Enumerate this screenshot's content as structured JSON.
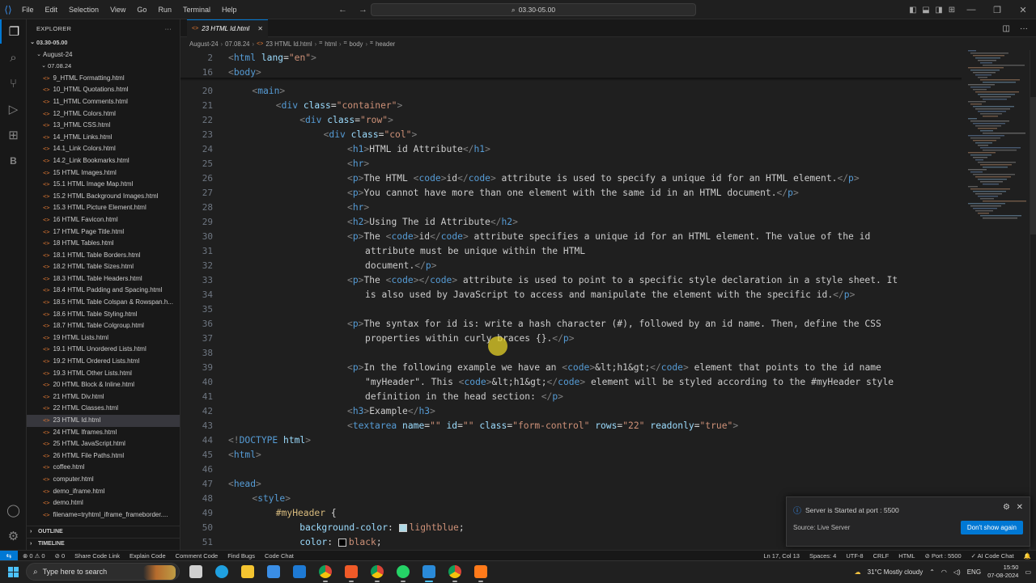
{
  "titlebar": {
    "menu": [
      "File",
      "Edit",
      "Selection",
      "View",
      "Go",
      "Run",
      "Terminal",
      "Help"
    ],
    "search": "03.30-05.00"
  },
  "sidebar": {
    "title": "EXPLORER",
    "root": "03.30-05.00",
    "folder": "August-24",
    "subfolder": "07.08.24",
    "files": [
      "9_HTML Formatting.html",
      "10_HTML Quotations.html",
      "11_HTML Comments.html",
      "12_HTML Colors.html",
      "13_HTML CSS.html",
      "14_HTML Links.html",
      "14.1_Link Colors.html",
      "14.2_Link Bookmarks.html",
      "15 HTML Images.html",
      "15.1 HTML Image Map.html",
      "15.2 HTML Background Images.html",
      "15.3 HTML Picture Element.html",
      "16 HTML Favicon.html",
      "17 HTML Page Title.html",
      "18 HTML Tables.html",
      "18.1 HTML Table Borders.html",
      "18.2 HTML Table Sizes.html",
      "18.3 HTML Table Headers.html",
      "18.4 HTML Padding and Spacing.html",
      "18.5 HTML Table Colspan & Rowspan.h...",
      "18.6 HTML Table Styling.html",
      "18.7 HTML Table Colgroup.html",
      "19 HTML Lists.html",
      "19.1 HTML Unordered Lists.html",
      "19.2 HTML Ordered Lists.html",
      "19.3 HTML Other Lists.html",
      "20 HTML Block & Inline.html",
      "21 HTML Div.html",
      "22 HTML Classes.html",
      "23 HTML Id.html",
      "24 HTML Iframes.html",
      "25 HTML JavaScript.html",
      "26 HTML File Paths.html",
      "coffee.html",
      "computer.html",
      "demo_iframe.html",
      "demo.html",
      "filename=tryhtml_iframe_frameborder...."
    ],
    "selected_index": 29,
    "outline": "OUTLINE",
    "timeline": "TIMELINE"
  },
  "tab": {
    "label": "23 HTML Id.html"
  },
  "breadcrumb": [
    "August-24",
    "07.08.24",
    "23 HTML Id.html",
    "html",
    "body",
    "header"
  ],
  "editor": {
    "sticky": [
      {
        "n": "2",
        "html": "<span class='t'>&lt;</span><span class='n'>html</span> <span class='a'>lang</span><span class='w'>=</span><span class='s'>\"en\"</span><span class='t'>&gt;</span>"
      },
      {
        "n": "16",
        "html": "<span class='t'>&lt;</span><span class='n'>body</span><span class='t'>&gt;</span>"
      }
    ],
    "lines": [
      {
        "n": "20",
        "i": 1,
        "html": "<span class='t'>&lt;</span><span class='n'>main</span><span class='t'>&gt;</span>"
      },
      {
        "n": "21",
        "i": 2,
        "html": "<span class='t'>&lt;</span><span class='n'>div</span> <span class='a'>class</span><span class='w'>=</span><span class='s'>\"container\"</span><span class='t'>&gt;</span>"
      },
      {
        "n": "22",
        "i": 3,
        "html": "<span class='t'>&lt;</span><span class='n'>div</span> <span class='a'>class</span><span class='w'>=</span><span class='s'>\"row\"</span><span class='t'>&gt;</span>"
      },
      {
        "n": "23",
        "i": 4,
        "html": "<span class='t'>&lt;</span><span class='n'>div</span> <span class='a'>class</span><span class='w'>=</span><span class='s'>\"col\"</span><span class='t'>&gt;</span>"
      },
      {
        "n": "24",
        "i": 5,
        "html": "<span class='t'>&lt;</span><span class='n'>h1</span><span class='t'>&gt;</span>HTML id Attribute<span class='t'>&lt;/</span><span class='n'>h1</span><span class='t'>&gt;</span>"
      },
      {
        "n": "25",
        "i": 5,
        "html": "<span class='t'>&lt;</span><span class='n'>hr</span><span class='t'>&gt;</span>"
      },
      {
        "n": "26",
        "i": 5,
        "html": "<span class='t'>&lt;</span><span class='n'>p</span><span class='t'>&gt;</span>The HTML <span class='t'>&lt;</span><span class='n'>code</span><span class='t'>&gt;</span>id<span class='t'>&lt;/</span><span class='n'>code</span><span class='t'>&gt;</span> attribute is used to specify a unique id for an HTML element.<span class='t'>&lt;/</span><span class='n'>p</span><span class='t'>&gt;</span>"
      },
      {
        "n": "27",
        "i": 5,
        "html": "<span class='t'>&lt;</span><span class='n'>p</span><span class='t'>&gt;</span>You cannot have more than one element with the same id in an HTML document.<span class='t'>&lt;/</span><span class='n'>p</span><span class='t'>&gt;</span>"
      },
      {
        "n": "28",
        "i": 5,
        "html": "<span class='t'>&lt;</span><span class='n'>hr</span><span class='t'>&gt;</span>"
      },
      {
        "n": "29",
        "i": 5,
        "html": "<span class='t'>&lt;</span><span class='n'>h2</span><span class='t'>&gt;</span>Using The id Attribute<span class='t'>&lt;/</span><span class='n'>h2</span><span class='t'>&gt;</span>"
      },
      {
        "n": "30",
        "i": 5,
        "html": "<span class='t'>&lt;</span><span class='n'>p</span><span class='t'>&gt;</span>The <span class='t'>&lt;</span><span class='n'>code</span><span class='t'>&gt;</span>id<span class='t'>&lt;/</span><span class='n'>code</span><span class='t'>&gt;</span> attribute specifies a unique id for an HTML element. The value of the id"
      },
      {
        "n": "31",
        "i": 5.75,
        "html": "attribute must be unique within the HTML"
      },
      {
        "n": "32",
        "i": 5.75,
        "html": "document.<span class='t'>&lt;/</span><span class='n'>p</span><span class='t'>&gt;</span>"
      },
      {
        "n": "33",
        "i": 5,
        "html": "<span class='t'>&lt;</span><span class='n'>p</span><span class='t'>&gt;</span>The <span class='t'>&lt;</span><span class='n'>code</span><span class='t'>&gt;&lt;/</span><span class='n'>code</span><span class='t'>&gt;</span> attribute is used to point to a specific style declaration in a style sheet. It"
      },
      {
        "n": "34",
        "i": 5.75,
        "html": "is also used by JavaScript to access and manipulate the element with the specific id.<span class='t'>&lt;/</span><span class='n'>p</span><span class='t'>&gt;</span>"
      },
      {
        "n": "35",
        "i": 0,
        "html": ""
      },
      {
        "n": "36",
        "i": 5,
        "html": "<span class='t'>&lt;</span><span class='n'>p</span><span class='t'>&gt;</span>The syntax for id is: write a hash character (#), followed by an id name. Then, define the CSS"
      },
      {
        "n": "37",
        "i": 5.75,
        "html": "properties within curly braces {}.<span class='t'>&lt;/</span><span class='n'>p</span><span class='t'>&gt;</span>"
      },
      {
        "n": "38",
        "i": 0,
        "html": ""
      },
      {
        "n": "39",
        "i": 5,
        "html": "<span class='t'>&lt;</span><span class='n'>p</span><span class='t'>&gt;</span>In the following example we have an <span class='t'>&lt;</span><span class='n'>code</span><span class='t'>&gt;</span>&amp;lt;h1&amp;gt;<span class='t'>&lt;/</span><span class='n'>code</span><span class='t'>&gt;</span> element that points to the id name"
      },
      {
        "n": "40",
        "i": 5.75,
        "html": "\"myHeader\". This <span class='t'>&lt;</span><span class='n'>code</span><span class='t'>&gt;</span>&amp;lt;h1&amp;gt;<span class='t'>&lt;/</span><span class='n'>code</span><span class='t'>&gt;</span> element will be styled according to the #myHeader style"
      },
      {
        "n": "41",
        "i": 5.75,
        "html": "definition in the head section: <span class='t'>&lt;/</span><span class='n'>p</span><span class='t'>&gt;</span>"
      },
      {
        "n": "42",
        "i": 5,
        "html": "<span class='t'>&lt;</span><span class='n'>h3</span><span class='t'>&gt;</span>Example<span class='t'>&lt;/</span><span class='n'>h3</span><span class='t'>&gt;</span>"
      },
      {
        "n": "43",
        "i": 5,
        "html": "<span class='t'>&lt;</span><span class='n'>textarea</span> <span class='a'>name</span><span class='w'>=</span><span class='s'>\"\"</span> <span class='a'>id</span><span class='w'>=</span><span class='s'>\"\"</span> <span class='a'>class</span><span class='w'>=</span><span class='s'>\"form-control\"</span> <span class='a'>rows</span><span class='w'>=</span><span class='s'>\"22\"</span> <span class='a'>readonly</span><span class='w'>=</span><span class='s'>\"true\"</span><span class='t'>&gt;</span>"
      },
      {
        "n": "44",
        "i": 0,
        "html": "<span class='t'>&lt;!</span><span class='n'>DOCTYPE</span> <span class='a'>html</span><span class='t'>&gt;</span>"
      },
      {
        "n": "45",
        "i": 0,
        "html": "<span class='t'>&lt;</span><span class='n'>html</span><span class='t'>&gt;</span>"
      },
      {
        "n": "46",
        "i": 0,
        "html": ""
      },
      {
        "n": "47",
        "i": 0,
        "html": "<span class='t'>&lt;</span><span class='n'>head</span><span class='t'>&gt;</span>"
      },
      {
        "n": "48",
        "i": 1,
        "html": "<span class='t'>&lt;</span><span class='n'>style</span><span class='t'>&gt;</span>"
      },
      {
        "n": "49",
        "i": 2,
        "html": "<span class='y'>#myHeader</span> <span class='w'>{</span>"
      },
      {
        "n": "50",
        "i": 3,
        "html": "<span class='a'>background-color</span><span class='w'>: </span><span style='display:inline-block;width:10px;height:10px;background:lightblue;border:1px solid #ccc;vertical-align:middle;margin-right:3px'></span><span class='s'>lightblue</span><span class='w'>;</span>"
      },
      {
        "n": "51",
        "i": 3,
        "html": "<span class='a'>color</span><span class='w'>: </span><span style='display:inline-block;width:10px;height:10px;background:black;border:1px solid #ccc;vertical-align:middle;margin-right:3px'></span><span class='s'>black</span><span class='w'>;</span>"
      }
    ]
  },
  "toast": {
    "message": "Server is Started at port : 5500",
    "source": "Source: Live Server",
    "button": "Don't show again"
  },
  "status": {
    "left": [
      "⊗ 0 ⚠ 0",
      "⊘ 0",
      "Share Code Link",
      "Explain Code",
      "Comment Code",
      "Find Bugs",
      "Code Chat"
    ],
    "right": [
      "Ln 17, Col 13",
      "Spaces: 4",
      "UTF-8",
      "CRLF",
      "HTML",
      "⊘ Port : 5500",
      "✓ AI Code Chat",
      "🔔"
    ]
  },
  "taskbar": {
    "search_placeholder": "Type here to search",
    "weather": "31°C  Mostly cloudy",
    "lang": "ENG",
    "time": "15:50",
    "date": "07-08-2024",
    "apps": [
      {
        "name": "task-view",
        "color": "#cfcfcf"
      },
      {
        "name": "edge",
        "color": "#1fa0e0"
      },
      {
        "name": "file-explorer",
        "color": "#f4c430"
      },
      {
        "name": "store",
        "color": "#3a8ee6"
      },
      {
        "name": "mail",
        "color": "#1e7ad4"
      },
      {
        "name": "chrome",
        "color": "#d9442b"
      },
      {
        "name": "brave",
        "color": "#f05a28"
      },
      {
        "name": "chrome-profile",
        "color": "#d9442b"
      },
      {
        "name": "whatsapp",
        "color": "#25d366"
      },
      {
        "name": "vscode",
        "color": "#2a8ad8"
      },
      {
        "name": "chrome-2",
        "color": "#e0a030"
      },
      {
        "name": "sublime",
        "color": "#ff7a1a"
      }
    ]
  },
  "colors": {
    "accent": "#0078d4",
    "editor_bg": "#1f1f1f",
    "sidebar_bg": "#181818"
  }
}
